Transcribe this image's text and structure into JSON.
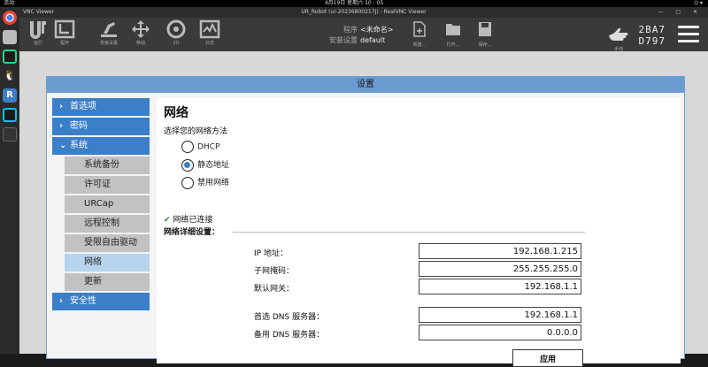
{
  "os_bar": {
    "left": "活动",
    "center": "4月19日 星期六 10 : 05",
    "right": "⏻ ▾"
  },
  "window": {
    "title": "UR_Robot (ur-20236800217J) - RealVNC Viewer",
    "app_name": "VNC Viewer",
    "controls": "— ▢ ✕"
  },
  "header": {
    "tools": [
      {
        "label": "运行",
        "icon": "run-icon"
      },
      {
        "label": "程序",
        "icon": "program-icon"
      },
      {
        "label": "安装设置",
        "icon": "installation-icon"
      },
      {
        "label": "移动",
        "icon": "move-icon"
      },
      {
        "label": "I/O",
        "icon": "io-icon"
      },
      {
        "label": "日志",
        "icon": "log-icon"
      }
    ],
    "program_label": "程序",
    "program_value": "<未命名>",
    "installation_label": "安装设置",
    "installation_value": "default",
    "file_tools": [
      {
        "label": "新建...",
        "icon": "new-file-icon"
      },
      {
        "label": "打开...",
        "icon": "open-folder-icon"
      },
      {
        "label": "保存...",
        "icon": "save-icon"
      }
    ],
    "manual_label": "手动",
    "serial_line1": "2BA7",
    "serial_line2": "D797"
  },
  "dialog": {
    "title": "设置",
    "sidebar": {
      "categories": [
        {
          "label": "首选项",
          "expanded": false
        },
        {
          "label": "密码",
          "expanded": false
        },
        {
          "label": "系统",
          "expanded": true
        },
        {
          "label": "安全性",
          "expanded": false
        }
      ],
      "system_items": [
        "系统备份",
        "许可证",
        "URCap",
        "远程控制",
        "受限自由驱动",
        "网络",
        "更新"
      ],
      "active_item": "网络"
    },
    "network": {
      "title": "网络",
      "method_label": "选择您的网络方法",
      "options": [
        "DHCP",
        "静态地址",
        "禁用网络"
      ],
      "selected": "静态地址",
      "status": "网络已连接",
      "details_label": "网络详细设置：",
      "fields": [
        {
          "label": "IP 地址：",
          "value": "192.168.1.215"
        },
        {
          "label": "子网掩码：",
          "value": "255.255.255.0"
        },
        {
          "label": "默认网关：",
          "value": "192.168.1.1"
        },
        {
          "label": "首选 DNS 服务器：",
          "value": "192.168.1.1"
        },
        {
          "label": "备用 DNS 服务器：",
          "value": "0.0.0.0"
        }
      ],
      "apply_label": "应用"
    }
  },
  "colors": {
    "accent": "#3a7fc7",
    "dialog_title": "#6b9bd1",
    "header": "#3a3a3a"
  }
}
